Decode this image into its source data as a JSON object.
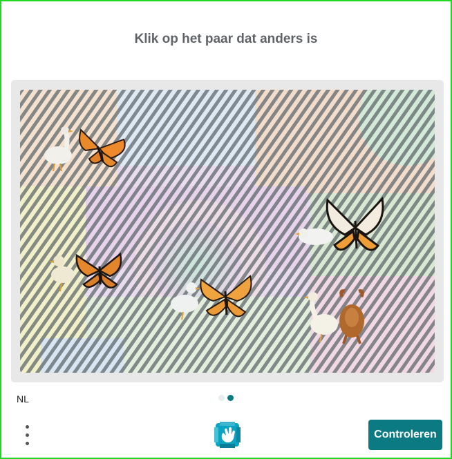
{
  "challenge": {
    "prompt": "Klik op het paar dat anders is",
    "pairs": [
      {
        "left": "goose",
        "right": "butterfly"
      },
      {
        "left": "duck",
        "right": "butterfly"
      },
      {
        "left": "duck",
        "right": "butterfly"
      },
      {
        "left": "duck",
        "right": "butterfly"
      },
      {
        "left": "goose",
        "right": "roast-chicken"
      }
    ]
  },
  "footer": {
    "language": "NL",
    "page_dots": {
      "total": 2,
      "active": 2
    },
    "verify_label": "Controleren"
  },
  "colors": {
    "accent": "#0b7a82",
    "frame_border": "#22d622",
    "title_text": "#5f6368",
    "dot_inactive": "#e6eef0",
    "dot_active": "#0b7a82"
  },
  "icons": {
    "menu": "vertical-ellipsis-icon",
    "logo": "hcaptcha-hand-logo-icon"
  }
}
